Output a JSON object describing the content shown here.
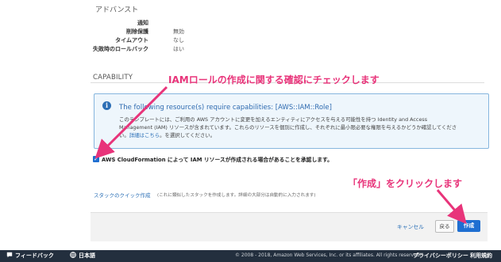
{
  "advanced": {
    "title": "アドバンスト",
    "rows": [
      {
        "label": "通知",
        "value": ""
      },
      {
        "label": "削除保護",
        "value": "無効"
      },
      {
        "label": "タイムアウト",
        "value": "なし"
      },
      {
        "label": "失敗時のロールバック",
        "value": "はい"
      }
    ]
  },
  "capability": {
    "title": "CAPABILITY",
    "heading": "The following resource(s) require capabilities: [AWS::IAM::Role]",
    "line1": "このテンプレートには、ご利用の AWS アカウントに変更を加えるエンティティにアクセスを与える可能性を持つ Identity and Access",
    "line2": "Management (IAM) リソースが含まれています。これらのリソースを個別に作成し、それぞれに最小限必要な権限を与えるかどうか確認してくださ",
    "line3_prefix": "い。",
    "line3_link": "詳細はこちら",
    "line3_suffix": "。を選択してください。",
    "ack_label": "AWS CloudFormation によって IAM リソースが作成される場合があることを承認します。",
    "ack_checked": true
  },
  "quick_create": {
    "link": "スタックのクイック作成",
    "note": "(これに類似したスタックを作成します。詳細の大部分は自動的に入力されます)"
  },
  "buttons": {
    "cancel": "キャンセル",
    "back": "戻る",
    "create": "作成"
  },
  "annotations": {
    "top": "IAMロールの作成に関する確認にチェックします",
    "bottom": "「作成」をクリックします",
    "color": "#e8347a"
  },
  "footer": {
    "feedback": "フィードバック",
    "language": "日本語",
    "copyright": "© 2008 - 2018, Amazon Web Services, Inc. or its affiliates. All rights reserved.",
    "privacy": "プライバシーポリシー",
    "terms": "利用規約"
  }
}
